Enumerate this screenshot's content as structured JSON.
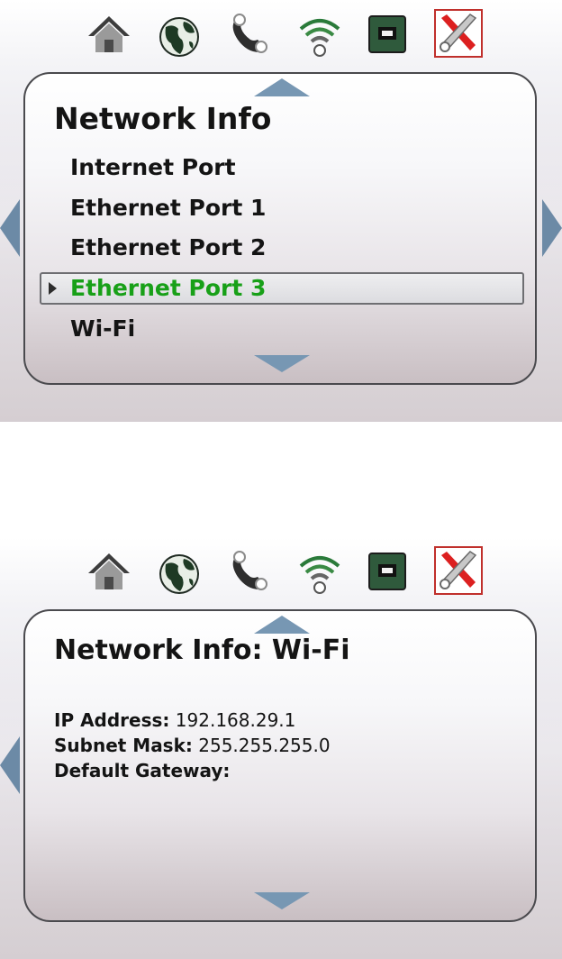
{
  "menu_screen": {
    "icons": [
      "home-icon",
      "globe-icon",
      "phone-icon",
      "wifi-icon",
      "ethernet-icon",
      "tools-icon"
    ],
    "title": "Network Info",
    "items": [
      {
        "label": "Internet Port",
        "selected": false
      },
      {
        "label": "Ethernet Port 1",
        "selected": false
      },
      {
        "label": "Ethernet Port 2",
        "selected": false
      },
      {
        "label": "Ethernet Port 3",
        "selected": true
      },
      {
        "label": "Wi-Fi",
        "selected": false
      }
    ]
  },
  "detail_screen": {
    "icons": [
      "home-icon",
      "globe-icon",
      "phone-icon",
      "wifi-icon",
      "ethernet-icon",
      "tools-icon"
    ],
    "title": "Network Info: Wi-Fi",
    "fields": [
      {
        "label": "IP Address:",
        "value": "192.168.29.1"
      },
      {
        "label": "Subnet Mask:",
        "value": "255.255.255.0"
      },
      {
        "label": "Default Gateway:",
        "value": ""
      }
    ]
  },
  "colors": {
    "selected_text": "#18a018",
    "nav_arrow": "#7797b3",
    "active_tool_border": "#c0302c"
  }
}
